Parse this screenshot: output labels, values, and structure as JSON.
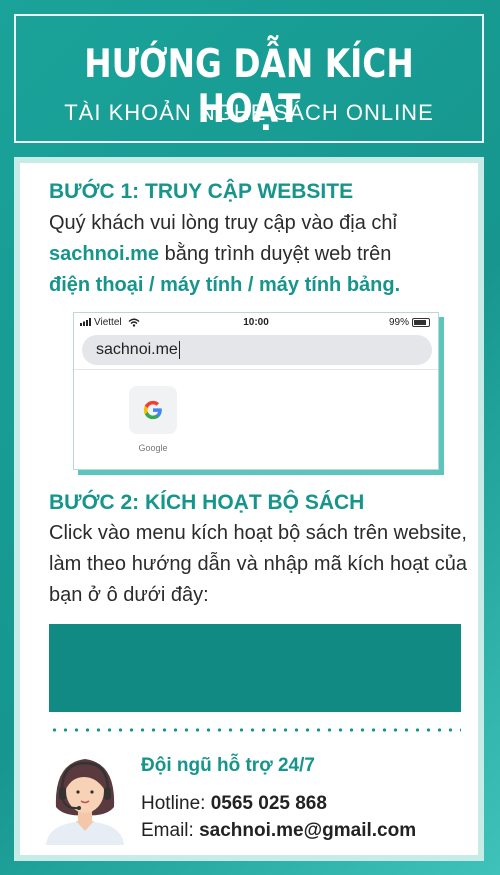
{
  "header": {
    "title": "HƯỚNG DẪN KÍCH HOẠT",
    "subtitle": "TÀI KHOẢN NGHE SÁCH ONLINE"
  },
  "step1": {
    "title": "BƯỚC 1: TRUY CẬP WEBSITE",
    "text_1": "Quý khách vui lòng truy cập vào địa chỉ",
    "highlight_site": "sachnoi.me",
    "text_2": " bằng trình duyệt web trên",
    "highlight_devices": "điện thoại / máy tính / máy tính bảng."
  },
  "phone": {
    "carrier": "Viettel",
    "time": "10:00",
    "battery": "99%",
    "url": "sachnoi.me",
    "shortcut_label": "Google",
    "icons": [
      "signal-icon",
      "wifi-icon",
      "battery-icon",
      "google-icon"
    ]
  },
  "step2": {
    "title": "BƯỚC 2: KÍCH HOẠT BỘ SÁCH",
    "text": "Click vào menu kích hoạt bộ sách trên website, làm theo hướng dẫn và nhập mã kích hoạt của bạn ở ô dưới đây:"
  },
  "support": {
    "title": "Đội ngũ hỗ trợ 24/7",
    "hotline_label": "Hotline: ",
    "hotline": "0565 025 868",
    "email_label": "Email: ",
    "email": "sachnoi.me@gmail.com"
  },
  "colors": {
    "teal": "#16958c",
    "code_box": "#118a83",
    "card_border": "#c7ebe7"
  }
}
